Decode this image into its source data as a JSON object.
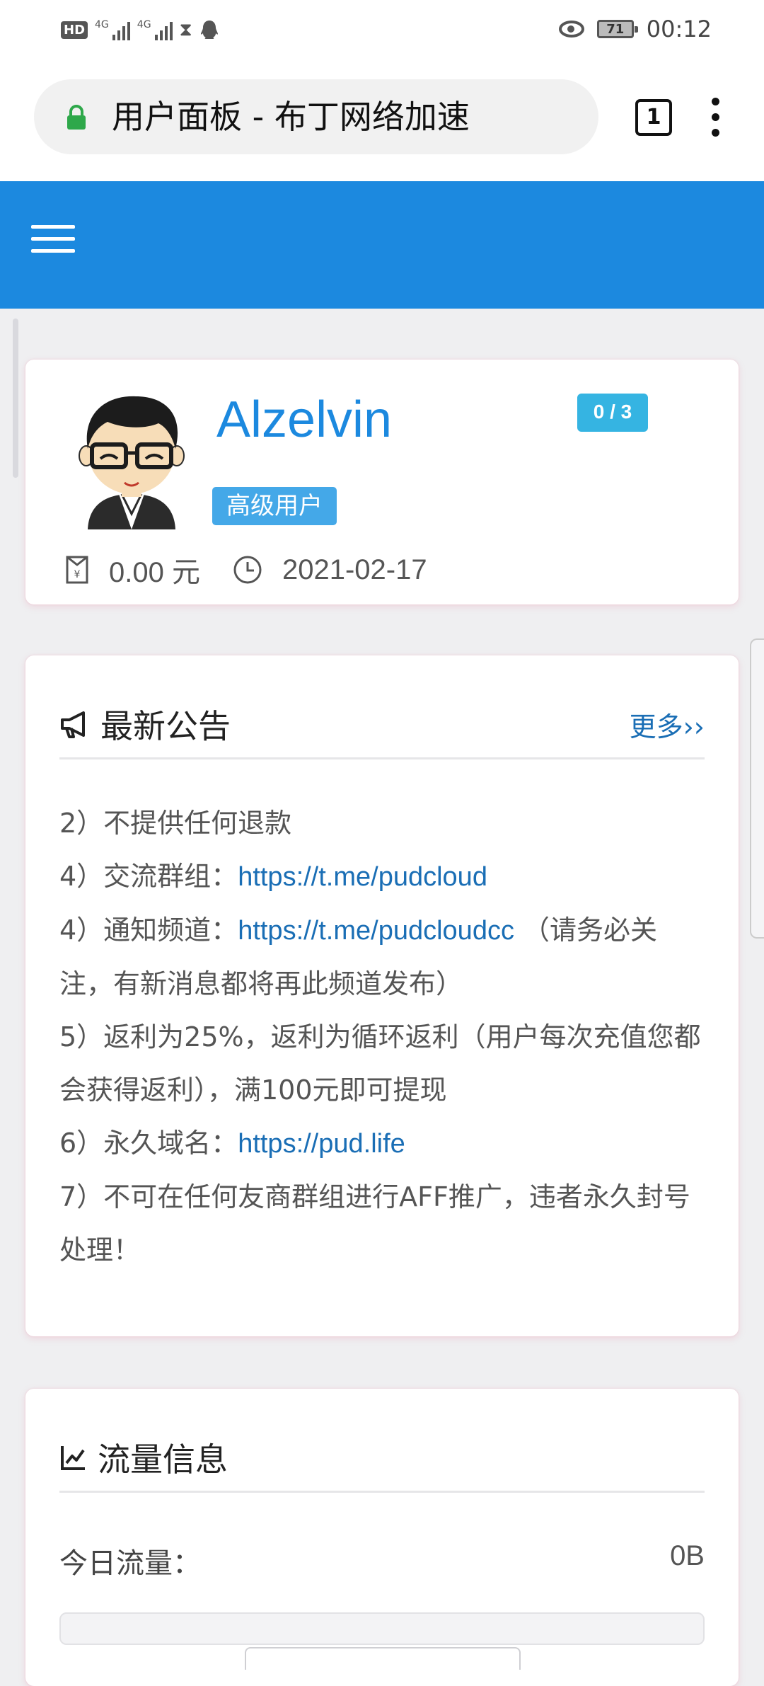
{
  "status_bar": {
    "hd_label": "HD",
    "network_1": "4G",
    "network_2": "4G",
    "battery_level": "71",
    "time": "00:12"
  },
  "browser": {
    "page_title": "用户面板 - 布丁网络加速",
    "tab_count": "1"
  },
  "profile": {
    "username": "Alzelvin",
    "device_count": "0 / 3",
    "level": "高级用户",
    "balance": "0.00 元",
    "expire_date": "2021-02-17"
  },
  "notice": {
    "title": "最新公告",
    "more_label": "更多››",
    "lines": {
      "l1": "2）不提供任何退款",
      "l2_prefix": "4）交流群组：",
      "l2_link": "https://t.me/pudcloud",
      "l3_prefix": "4）通知频道：",
      "l3_link": "https://t.me/pudcloudcc",
      "l3_suffix": "（请务必关注，有新消息都将再此频道发布）",
      "l4": "5）返利为25%，返利为循环返利（用户每次充值您都会获得返利），满100元即可提现",
      "l5_prefix": "6）永久域名：",
      "l5_link": "https://pud.life",
      "l6": "7）不可在任何友商群组进行AFF推广，违者永久封号处理！"
    }
  },
  "traffic": {
    "title": "流量信息",
    "today_label": "今日流量：",
    "today_value": "0B",
    "today_fraction": 0
  },
  "icons": {
    "lock": "lock-icon",
    "megaphone": "megaphone-icon",
    "chart": "line-chart-icon",
    "wallet": "wallet-icon",
    "clock": "clock-icon"
  },
  "colors": {
    "primary": "#1c89df",
    "link": "#1a6eb5",
    "badge_cyan": "#35b4e2",
    "badge_blue": "#44a8e8",
    "lock_green": "#2ea84a"
  }
}
